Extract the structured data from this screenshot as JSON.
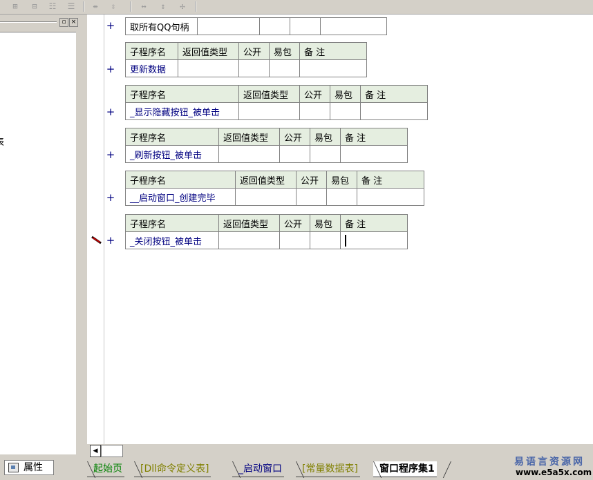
{
  "toolbar": {
    "icons": [
      "table-insert-col-icon",
      "table-row-icon",
      "table-merge-icon",
      "table-split-icon",
      "col-width-icon",
      "row-height-icon",
      "fit-width-icon",
      "fit-height-icon",
      "fit-all-icon"
    ]
  },
  "left_panel": {
    "restore_glyph": "▫",
    "close_glyph": "×",
    "cut_char": "表"
  },
  "properties_tab": {
    "label": "属性"
  },
  "editor": {
    "first_row": {
      "name": "取所有QQ句柄"
    },
    "headers": {
      "name": "子程序名",
      "return_type": "返回值类型",
      "public": "公开",
      "easy_pack": "易包",
      "remark": "备 注"
    },
    "plus_glyph": "+",
    "subroutines": [
      {
        "name": "更新数据"
      },
      {
        "name": "_显示隐藏按钮_被单击"
      },
      {
        "name": "_刷新按钮_被单击"
      },
      {
        "name": "__启动窗口_创建完毕"
      },
      {
        "name": "_关闭按钮_被单击"
      }
    ]
  },
  "hscroll": {
    "left_arrow": "◀"
  },
  "tabs": [
    {
      "label": "起始页",
      "color": "#008000"
    },
    {
      "label": "[Dll命令定义表]",
      "color": "#808000"
    },
    {
      "label": "_启动窗口",
      "color": "#000080"
    },
    {
      "label": "[常量数据表]",
      "color": "#808000"
    },
    {
      "label": "窗口程序集1",
      "color": "#000000",
      "active": true
    }
  ],
  "watermark": {
    "site_name": "易语言资源网",
    "url": "www.e5a5x.com"
  }
}
